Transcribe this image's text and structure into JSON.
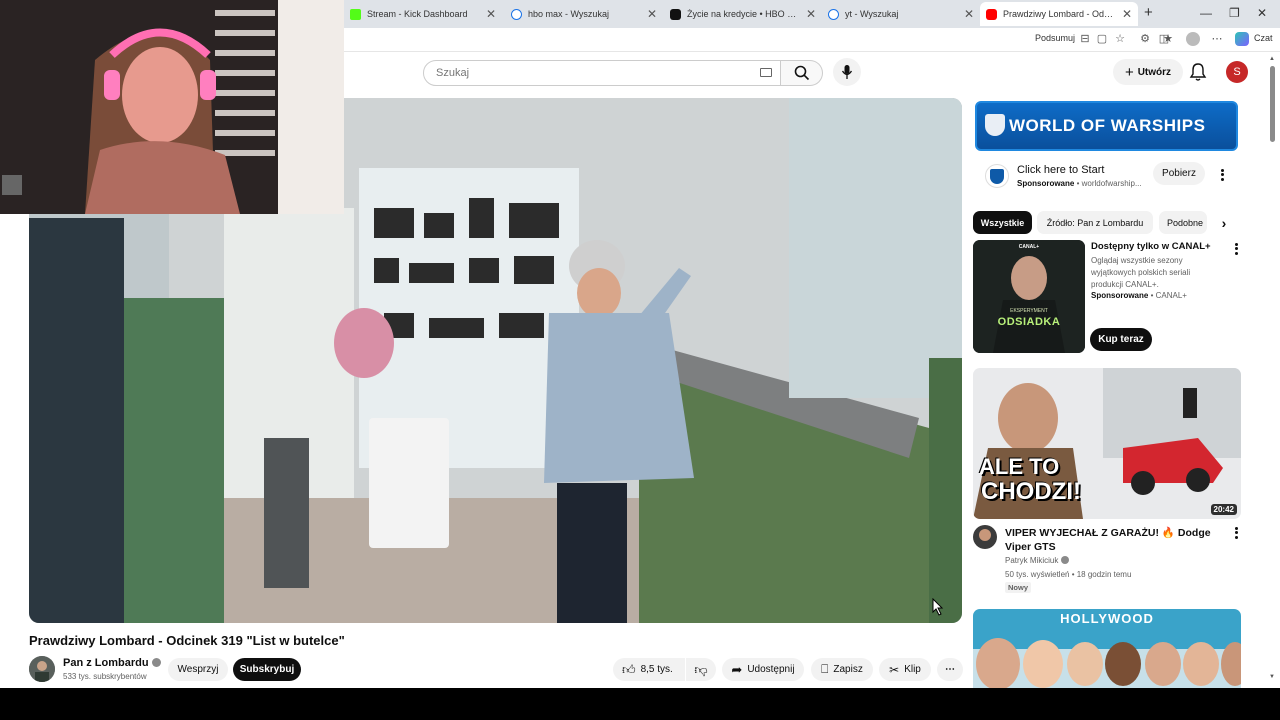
{
  "browser": {
    "tabs": [
      {
        "title": "Stream - Kick Dashboard",
        "color": "#53fc18"
      },
      {
        "title": "hbo max - Wyszukaj",
        "color": "#1a73e8"
      },
      {
        "title": "Życie na kredycie • HBO Max",
        "color": "#111111"
      },
      {
        "title": "yt - Wyszukaj",
        "color": "#1a73e8"
      },
      {
        "title": "Prawdziwy Lombard - Odcine",
        "color": "#ff0000"
      }
    ],
    "toolbar": {
      "summarize_label": "Podsumuj",
      "chat_label": "Czat"
    }
  },
  "youtube": {
    "search": {
      "placeholder": "Szukaj"
    },
    "create_label": "Utwórz",
    "avatar_letter": "S"
  },
  "video": {
    "title": "Prawdziwy Lombard - Odcinek 319 \"List w butelce\"",
    "channel": "Pan z Lombardu",
    "subscribers": "533 tys. subskrybentów",
    "support_label": "Wesprzyj",
    "subscribe_label": "Subskrybuj",
    "likes": "8,5 tys.",
    "share_label": "Udostępnij",
    "save_label": "Zapisz",
    "clip_label": "Klip"
  },
  "sidebar": {
    "ad": {
      "banner_text": "WORLD OF WARSHIPS",
      "title": "Click here to Start",
      "sponsored": "Sponsorowane",
      "domain": "worldofwarship...",
      "cta": "Pobierz"
    },
    "chips": [
      "Wszystkie",
      "Źródło: Pan z Lombardu",
      "Podobne"
    ],
    "promo": {
      "title": "Dostępny tylko w CANAL+",
      "description": "Oglądaj wszystkie sezony wyjątkowych polskich seriali produkcji CANAL+.",
      "sponsored": "Sponsorowane",
      "advertiser": "CANAL+",
      "cta": "Kup teraz",
      "thumb_brand": "CANAL+",
      "thumb_subtitle": "EKSPERYMENT",
      "thumb_title": "ODSIADKA"
    },
    "videos": [
      {
        "title": "VIPER WYJECHAŁ Z GARAŻU! 🔥 Dodge Viper GTS",
        "channel": "Patryk Mikiciuk",
        "meta": "50 tys. wyświetleń • 18 godzin temu",
        "badge": "Nowy",
        "duration": "20:42",
        "thumb_text_1": "ALE TO",
        "thumb_text_2": "CHODZI!"
      },
      {
        "thumb_text": "HOLLYWOOD"
      }
    ]
  }
}
